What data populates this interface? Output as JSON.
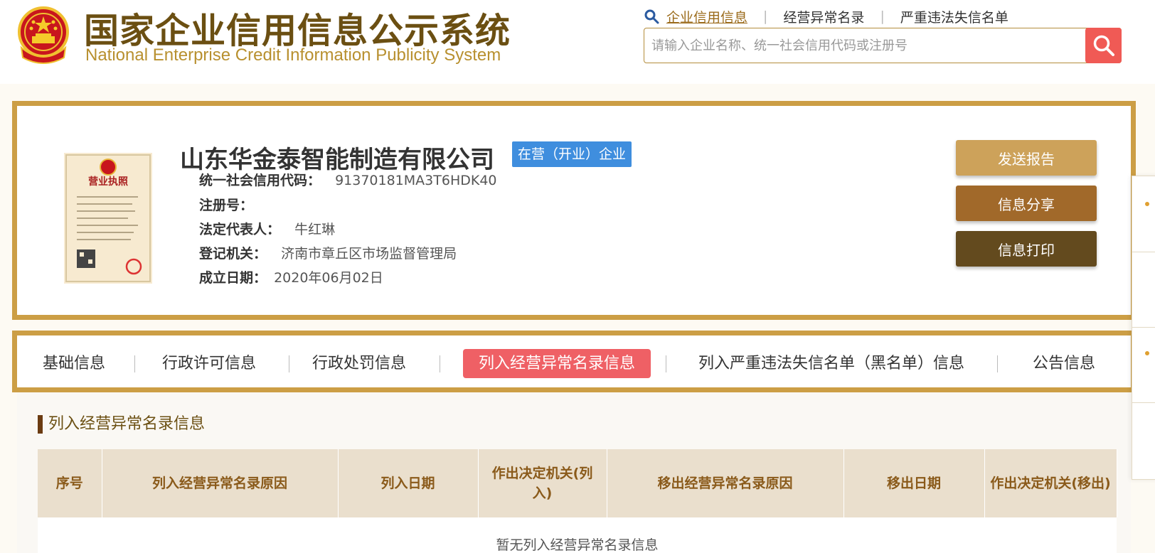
{
  "header": {
    "title_cn": "国家企业信用信息公示系统",
    "title_en": "National Enterprise Credit Information Publicity System",
    "nav": [
      "企业信用信息",
      "经营异常名录",
      "严重违法失信名单"
    ],
    "search_placeholder": "请输入企业名称、统一社会信用代码或注册号"
  },
  "company": {
    "name": "山东华金泰智能制造有限公司",
    "status": "在营（开业）企业",
    "fields": [
      {
        "label": "统一社会信用代码：",
        "value": "91370181MA3T6HDK40"
      },
      {
        "label": "注册号：",
        "value": ""
      },
      {
        "label": "法定代表人：",
        "value": "牛红琳"
      },
      {
        "label": "登记机关：",
        "value": "济南市章丘区市场监督管理局"
      },
      {
        "label": "成立日期：",
        "value": "2020年06月02日"
      }
    ],
    "license_image_text": "营业执照"
  },
  "actions": {
    "send": "发送报告",
    "share": "信息分享",
    "print": "信息打印"
  },
  "tabs": [
    "基础信息",
    "行政许可信息",
    "行政处罚信息",
    "列入经营异常名录信息",
    "列入严重违法失信名单（黑名单）信息",
    "公告信息"
  ],
  "active_tab": "列入经营异常名录信息",
  "section": {
    "title": "列入经营异常名录信息",
    "columns": [
      "序号",
      "列入经营异常名录原因",
      "列入日期",
      "作出决定机关(列入)",
      "移出经营异常名录原因",
      "移出日期",
      "作出决定机关(移出)"
    ],
    "empty_text": "暂无列入经营异常名录信息"
  },
  "colors": {
    "brand_gold": "#cc9e45",
    "brand_brown": "#6b4f12",
    "status_blue": "#3f8ede",
    "active_tab_red": "#ef6065",
    "search_red": "#f05a55"
  }
}
